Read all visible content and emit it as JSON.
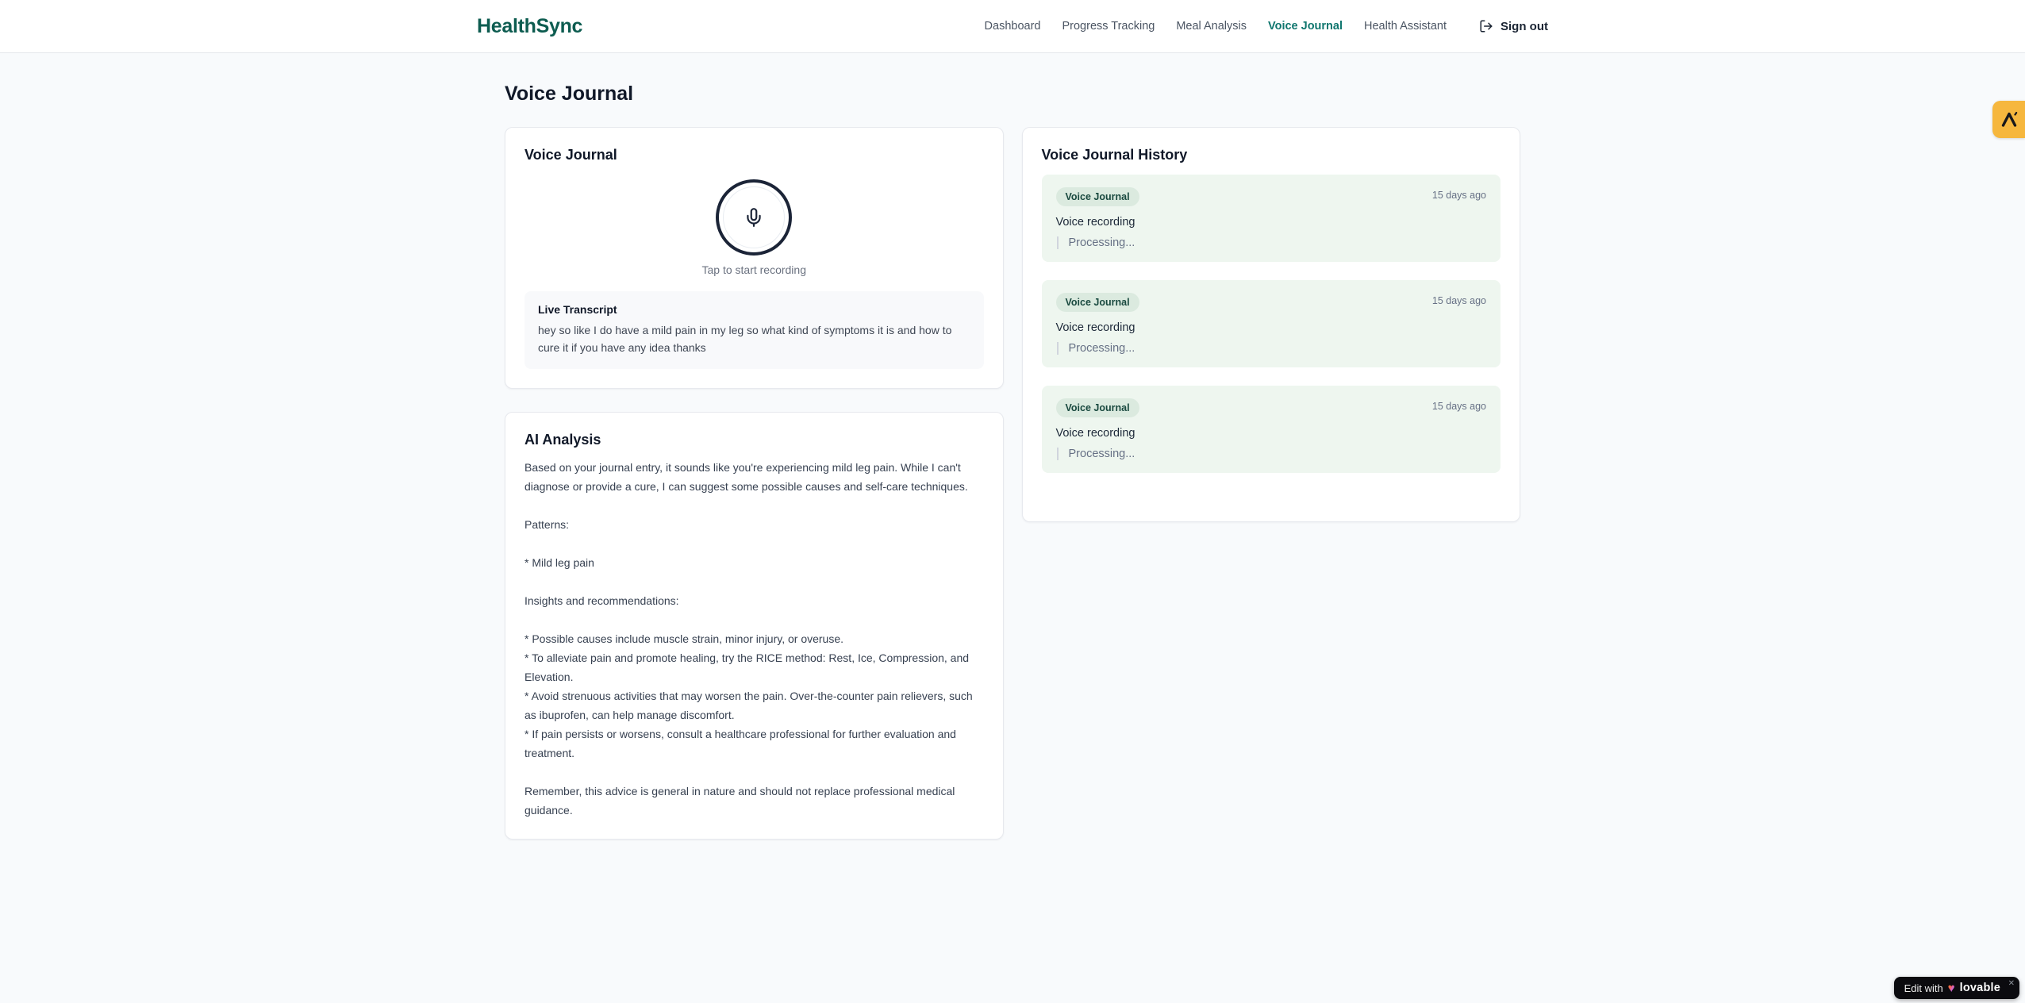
{
  "brand": {
    "name": "HealthSync"
  },
  "nav": {
    "items": [
      {
        "label": "Dashboard",
        "active": false
      },
      {
        "label": "Progress Tracking",
        "active": false
      },
      {
        "label": "Meal Analysis",
        "active": false
      },
      {
        "label": "Voice Journal",
        "active": true
      },
      {
        "label": "Health Assistant",
        "active": false
      }
    ],
    "sign_out_label": "Sign out"
  },
  "page": {
    "title": "Voice Journal"
  },
  "recorder_card": {
    "title": "Voice Journal",
    "tap_hint": "Tap to start recording",
    "transcript_title": "Live Transcript",
    "transcript_text": "hey so like I do have a mild pain in my leg so what kind of symptoms it is and how to cure it if you have any idea thanks"
  },
  "analysis_card": {
    "title": "AI Analysis",
    "body": "Based on your journal entry, it sounds like you're experiencing mild leg pain. While I can't diagnose or provide a cure, I can suggest some possible causes and self-care techniques.\n\nPatterns:\n\n* Mild leg pain\n\nInsights and recommendations:\n\n* Possible causes include muscle strain, minor injury, or overuse.\n* To alleviate pain and promote healing, try the RICE method: Rest, Ice, Compression, and Elevation.\n* Avoid strenuous activities that may worsen the pain. Over-the-counter pain relievers, such as ibuprofen, can help manage discomfort.\n* If pain persists or worsens, consult a healthcare professional for further evaluation and treatment.\n\nRemember, this advice is general in nature and should not replace professional medical guidance."
  },
  "history_card": {
    "title": "Voice Journal History",
    "entries": [
      {
        "badge": "Voice Journal",
        "time": "15 days ago",
        "label": "Voice recording",
        "status": "Processing..."
      },
      {
        "badge": "Voice Journal",
        "time": "15 days ago",
        "label": "Voice recording",
        "status": "Processing..."
      },
      {
        "badge": "Voice Journal",
        "time": "15 days ago",
        "label": "Voice recording",
        "status": "Processing..."
      }
    ]
  },
  "widgets": {
    "edit_badge": {
      "prefix": "Edit with",
      "brand": "lovable",
      "heart": "♥",
      "close": "✕"
    }
  },
  "colors": {
    "brand_teal": "#0d5c50",
    "active_nav": "#0f766e",
    "page_bg": "#f8fafc",
    "entry_bg": "#eef6ef",
    "badge_bg": "#dbeadf",
    "badge_text": "#19493f",
    "feedback_tab": "#f6b73e",
    "edit_badge_bg": "#0b0b0f"
  }
}
